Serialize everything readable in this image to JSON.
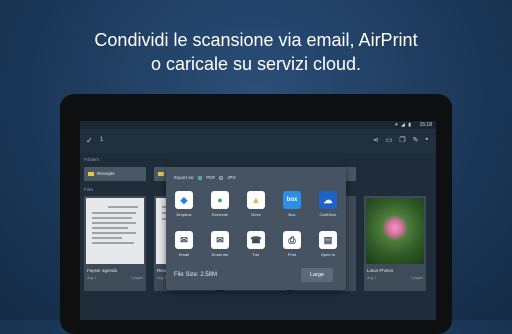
{
  "headline": {
    "line1": "Condividi le scansione via email, AirPrint",
    "line2": "o caricale su servizi cloud."
  },
  "statusbar": {
    "time": "15:18"
  },
  "toolbar": {
    "back_icon": "check-icon",
    "count": "1"
  },
  "sections": {
    "folders": "Folders",
    "files": "Files"
  },
  "folders": [
    {
      "name": "Receipts"
    },
    {
      "name": ""
    },
    {
      "name": ""
    },
    {
      "name": ""
    }
  ],
  "files": [
    {
      "name": "Fayser agenda",
      "date": "Aug 1",
      "pages": "1 pages"
    },
    {
      "name": "Recei",
      "date": "Aug 1",
      "pages": ""
    },
    {
      "name": "",
      "date": "",
      "pages": ""
    },
    {
      "name": "",
      "date": "",
      "pages": ""
    },
    {
      "name": "Lotus Photos",
      "date": "Aug 1",
      "pages": "1 pages"
    }
  ],
  "dialog": {
    "export_label": "Export as:",
    "format_pdf": "PDF",
    "format_jpg": "JPG",
    "selected_format": "PDF",
    "apps_row1": [
      {
        "label": "Dropbox",
        "icon": "dropbox-icon",
        "color": "#2d7de0"
      },
      {
        "label": "Evernote",
        "icon": "evernote-icon",
        "color": "#3aa84a"
      },
      {
        "label": "Drive",
        "icon": "drive-icon",
        "color": "#f2b02a"
      },
      {
        "label": "Box",
        "icon": "box-icon",
        "color": "#2a8fe6"
      },
      {
        "label": "OneDrive",
        "icon": "onedrive-icon",
        "color": "#1e63c8"
      }
    ],
    "apps_row2": [
      {
        "label": "Email",
        "icon": "email-icon",
        "color": "#3b4a5a"
      },
      {
        "label": "Email me",
        "icon": "email-me-icon",
        "color": "#3b4a5a"
      },
      {
        "label": "Fax",
        "icon": "fax-icon",
        "color": "#3b4a5a"
      },
      {
        "label": "Print",
        "icon": "print-icon",
        "color": "#3b4a5a"
      },
      {
        "label": "Open in",
        "icon": "open-in-icon",
        "color": "#3b4a5a"
      }
    ],
    "file_size": "File Size: 2.58M",
    "size_button": "Large"
  }
}
